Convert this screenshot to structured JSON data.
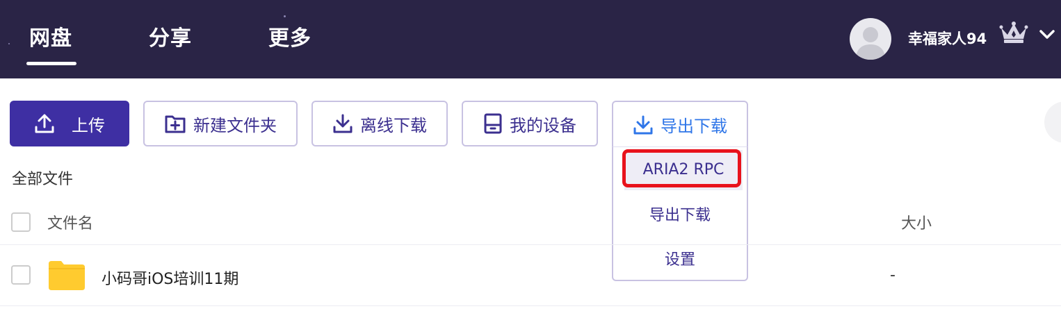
{
  "nav": {
    "items": [
      {
        "label": "网盘",
        "active": true
      },
      {
        "label": "分享",
        "active": false
      },
      {
        "label": "更多",
        "active": false
      }
    ]
  },
  "user": {
    "name": "幸福家人94",
    "avatar_icon": "user-silhouette",
    "badge_icon": "crown-icon",
    "menu_icon": "chevron-down-icon"
  },
  "toolbar": {
    "upload": "上传",
    "new_folder": "新建文件夹",
    "offline_download": "离线下载",
    "my_devices": "我的设备",
    "export_download": "导出下载"
  },
  "export_menu": {
    "items": [
      "ARIA2 RPC",
      "导出下载",
      "设置"
    ],
    "highlighted_index": 0,
    "highlight_color": "#e8121c"
  },
  "breadcrumb": "全部文件",
  "file_table": {
    "columns": {
      "name": "文件名",
      "size": "大小"
    },
    "rows": [
      {
        "name": "小码哥iOS培训11期",
        "size": "-",
        "type": "folder"
      }
    ]
  },
  "colors": {
    "topbar": "#2a2446",
    "primary": "#3e2fa3",
    "accent_blue": "#2f76e8",
    "folder": "#ffcb2f"
  }
}
